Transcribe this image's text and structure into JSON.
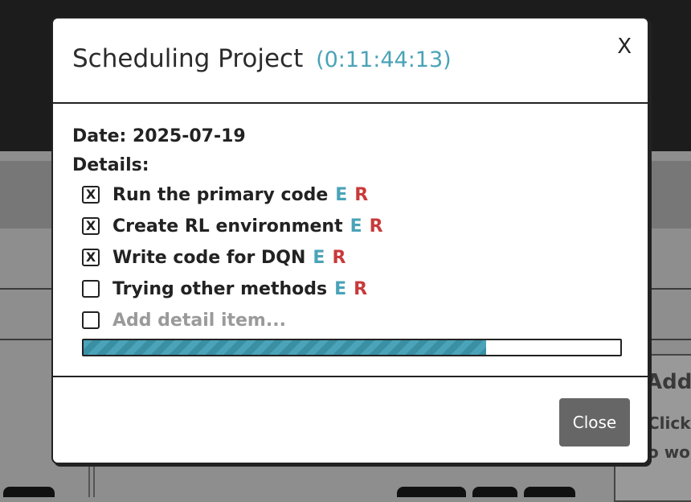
{
  "modal": {
    "title": "Scheduling Project",
    "timer": "(0:11:44:13)",
    "close_x": "X",
    "date_line": "Date: 2025-07-19",
    "details_label": "Details:",
    "items": [
      {
        "label": "Run the primary code",
        "checked": true,
        "checkbox": "X",
        "edit": "E",
        "remove": "R"
      },
      {
        "label": "Create RL environment",
        "checked": true,
        "checkbox": "X",
        "edit": "E",
        "remove": "R"
      },
      {
        "label": "Write code for DQN",
        "checked": true,
        "checkbox": "X",
        "edit": "E",
        "remove": "R"
      },
      {
        "label": "Trying other methods",
        "checked": false,
        "checkbox": "",
        "edit": "E",
        "remove": "R"
      }
    ],
    "add_placeholder": "Add detail item...",
    "progress_fraction": 0.75,
    "close_button": "Close"
  },
  "background": {
    "card_title": "Add t",
    "card_line1": "Click t",
    "card_line2": "o wo"
  },
  "colors": {
    "accent": "#4aa3b8",
    "remove": "#c83a3a",
    "button": "#666666"
  }
}
